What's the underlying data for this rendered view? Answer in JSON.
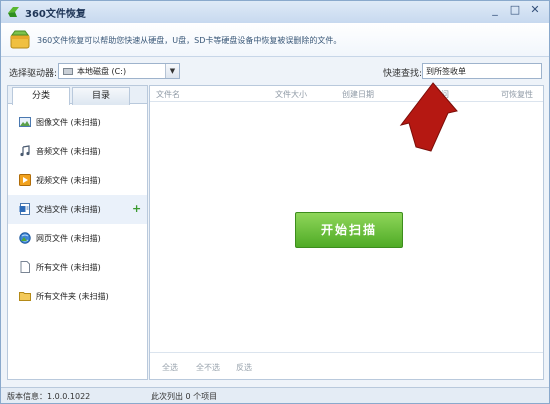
{
  "window": {
    "title": "360文件恢复"
  },
  "banner": {
    "text": "360文件恢复可以帮助您快速从硬盘，U盘，SD卡等硬盘设备中恢复被误删除的文件。"
  },
  "drive": {
    "label": "选择驱动器:",
    "value": "本地磁盘 (C:)"
  },
  "search": {
    "label": "快速查找:",
    "value": "到所签收单"
  },
  "tabs": [
    {
      "label": "分类"
    },
    {
      "label": "目录"
    }
  ],
  "categories": [
    {
      "label": "图像文件 (未扫描)",
      "icon": "image-icon"
    },
    {
      "label": "音频文件 (未扫描)",
      "icon": "music-note-icon"
    },
    {
      "label": "视频文件 (未扫描)",
      "icon": "video-icon"
    },
    {
      "label": "文档文件 (未扫描)",
      "icon": "document-icon",
      "selected": true,
      "add": "+"
    },
    {
      "label": "网页文件 (未扫描)",
      "icon": "web-page-icon"
    },
    {
      "label": "所有文件 (未扫描)",
      "icon": "blank-file-icon"
    },
    {
      "label": "所有文件夹 (未扫描)",
      "icon": "folder-icon"
    }
  ],
  "columns": {
    "name": "文件名",
    "size": "文件大小",
    "date": "创建日期",
    "access": "访问",
    "recover": "可恢复性"
  },
  "scan_button": "开始扫描",
  "actions": {
    "select_all": "全选",
    "select_none": "全不选",
    "invert": "反选"
  },
  "status": {
    "version": "版本信息：1.0.0.1022",
    "count": "此次列出 0 个项目"
  },
  "colors": {
    "accent_green": "#4fab26",
    "annotation_red": "#b51812",
    "title_blue": "#1e3557"
  }
}
